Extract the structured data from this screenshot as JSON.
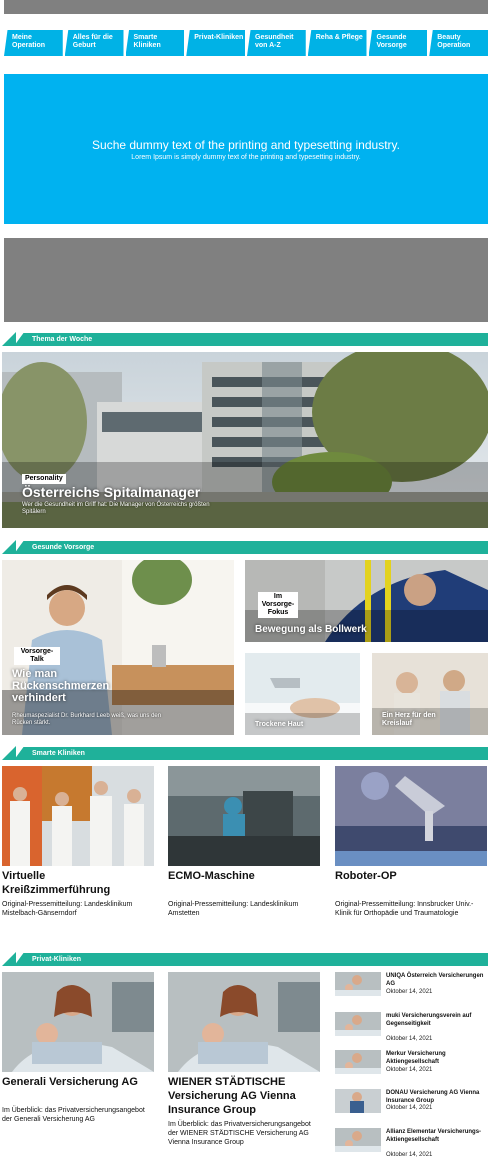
{
  "nav": {
    "items": [
      {
        "label": "Meine Operation"
      },
      {
        "label": "Alles für die Geburt"
      },
      {
        "label": "Smarte Kliniken"
      },
      {
        "label": "Privat-Kliniken"
      },
      {
        "label": "Gesundheit von A-Z"
      },
      {
        "label": "Reha & Pflege"
      },
      {
        "label": "Gesunde Vorsorge"
      },
      {
        "label": "Beauty Operation"
      }
    ]
  },
  "hero": {
    "title": "Suche dummy text of the printing and typesetting industry.",
    "subtitle": "Lorem Ipsum is simply dummy text of the printing and typesetting industry."
  },
  "thema": {
    "section_label": "Thema der Woche",
    "tag": "Personality",
    "title": "Österreichs Spitalmanager",
    "desc": "Wer die Gesundheit im Griff hat: Die Manager von Österreichs größten Spitälern"
  },
  "vorsorge": {
    "section_label": "Gesunde Vorsorge",
    "main": {
      "tag": "Vorsorge-Talk",
      "title": "Wie man Rückenschmerzen verhindert",
      "desc": "Rheumaspezialist Dr. Burkhard Leeb weiß, was uns den Rücken stärkt."
    },
    "top_right": {
      "tag": "Im Vorsorge-Fokus",
      "title": "Bewegung als Bollwerk"
    },
    "bottom_left": {
      "title": "Trockene Haut"
    },
    "bottom_right": {
      "title": "Ein Herz für den Kreislauf"
    }
  },
  "smarte": {
    "section_label": "Smarte Kliniken",
    "cards": [
      {
        "title": "Virtuelle Kreißzimmerführung",
        "desc": "Original-Pressemitteilung: Landesklinikum Mistelbach-Gänserndorf"
      },
      {
        "title": "ECMO-Maschine",
        "desc": "Original-Pressemitteilung: Landesklinikum Amstetten"
      },
      {
        "title": "Roboter-OP",
        "desc": "Original-Pressemitteilung: Innsbrucker Univ.-Klinik für Orthopädie und Traumatologie"
      }
    ]
  },
  "privat": {
    "section_label": "Privat-Kliniken",
    "cards": [
      {
        "title": "Generali Versicherung AG",
        "desc": "Im Überblick: das Privatversicherungsangebot der Generali Versicherung AG"
      },
      {
        "title": "WIENER STÄDTISCHE Versicherung AG Vienna Insurance Group",
        "desc": "Im Überblick: das Privatversicherungsangebot der WIENER STÄDTISCHE Versicherung AG Vienna Insurance Group"
      }
    ],
    "side": [
      {
        "title": "UNIQA Österreich Versicherungen AG",
        "date": "Oktober 14, 2021"
      },
      {
        "title": "muki Versicherungsverein auf Gegenseitigkeit",
        "date": "Oktober 14, 2021"
      },
      {
        "title": "Merkur Versicherung Aktiengesellschaft",
        "date": "Oktober 14, 2021"
      },
      {
        "title": "DONAU Versicherung AG Vienna Insurance Group",
        "date": "Oktober 14, 2021"
      },
      {
        "title": "Allianz Elementar Versicherungs-Aktiengesellschaft",
        "date": "Oktober 14, 2021"
      }
    ]
  },
  "colors": {
    "nav": "#00b2e6",
    "hero": "#00b2f0",
    "section": "#1fb19a",
    "gray": "#808080"
  }
}
